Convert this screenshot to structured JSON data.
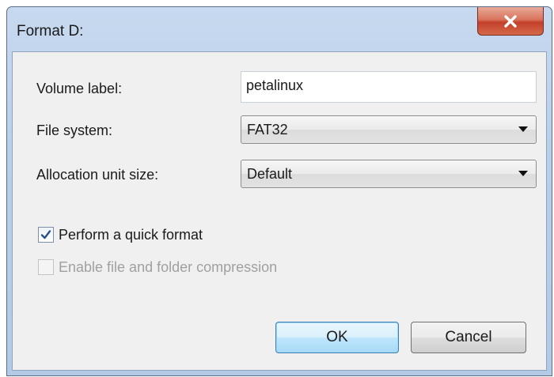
{
  "window": {
    "title": "Format D:"
  },
  "form": {
    "volume_label": {
      "label": "Volume label:",
      "value": "petalinux"
    },
    "file_system": {
      "label": "File system:",
      "selected": "FAT32"
    },
    "allocation_unit_size": {
      "label": "Allocation unit size:",
      "selected": "Default"
    }
  },
  "options": {
    "quick_format": {
      "label": "Perform a quick format",
      "checked": true,
      "enabled": true
    },
    "compression": {
      "label": "Enable file and folder compression",
      "checked": false,
      "enabled": false
    }
  },
  "buttons": {
    "ok_label": "OK",
    "cancel_label": "Cancel"
  },
  "icons": {
    "close": "close-icon",
    "dropdown": "chevron-down-icon",
    "check": "checkmark-icon"
  },
  "colors": {
    "title_gradient_top": "#c7d9ef",
    "close_red": "#c4402a",
    "ok_border": "#3c7fb1",
    "dialog_bg": "#f0f0f0"
  }
}
